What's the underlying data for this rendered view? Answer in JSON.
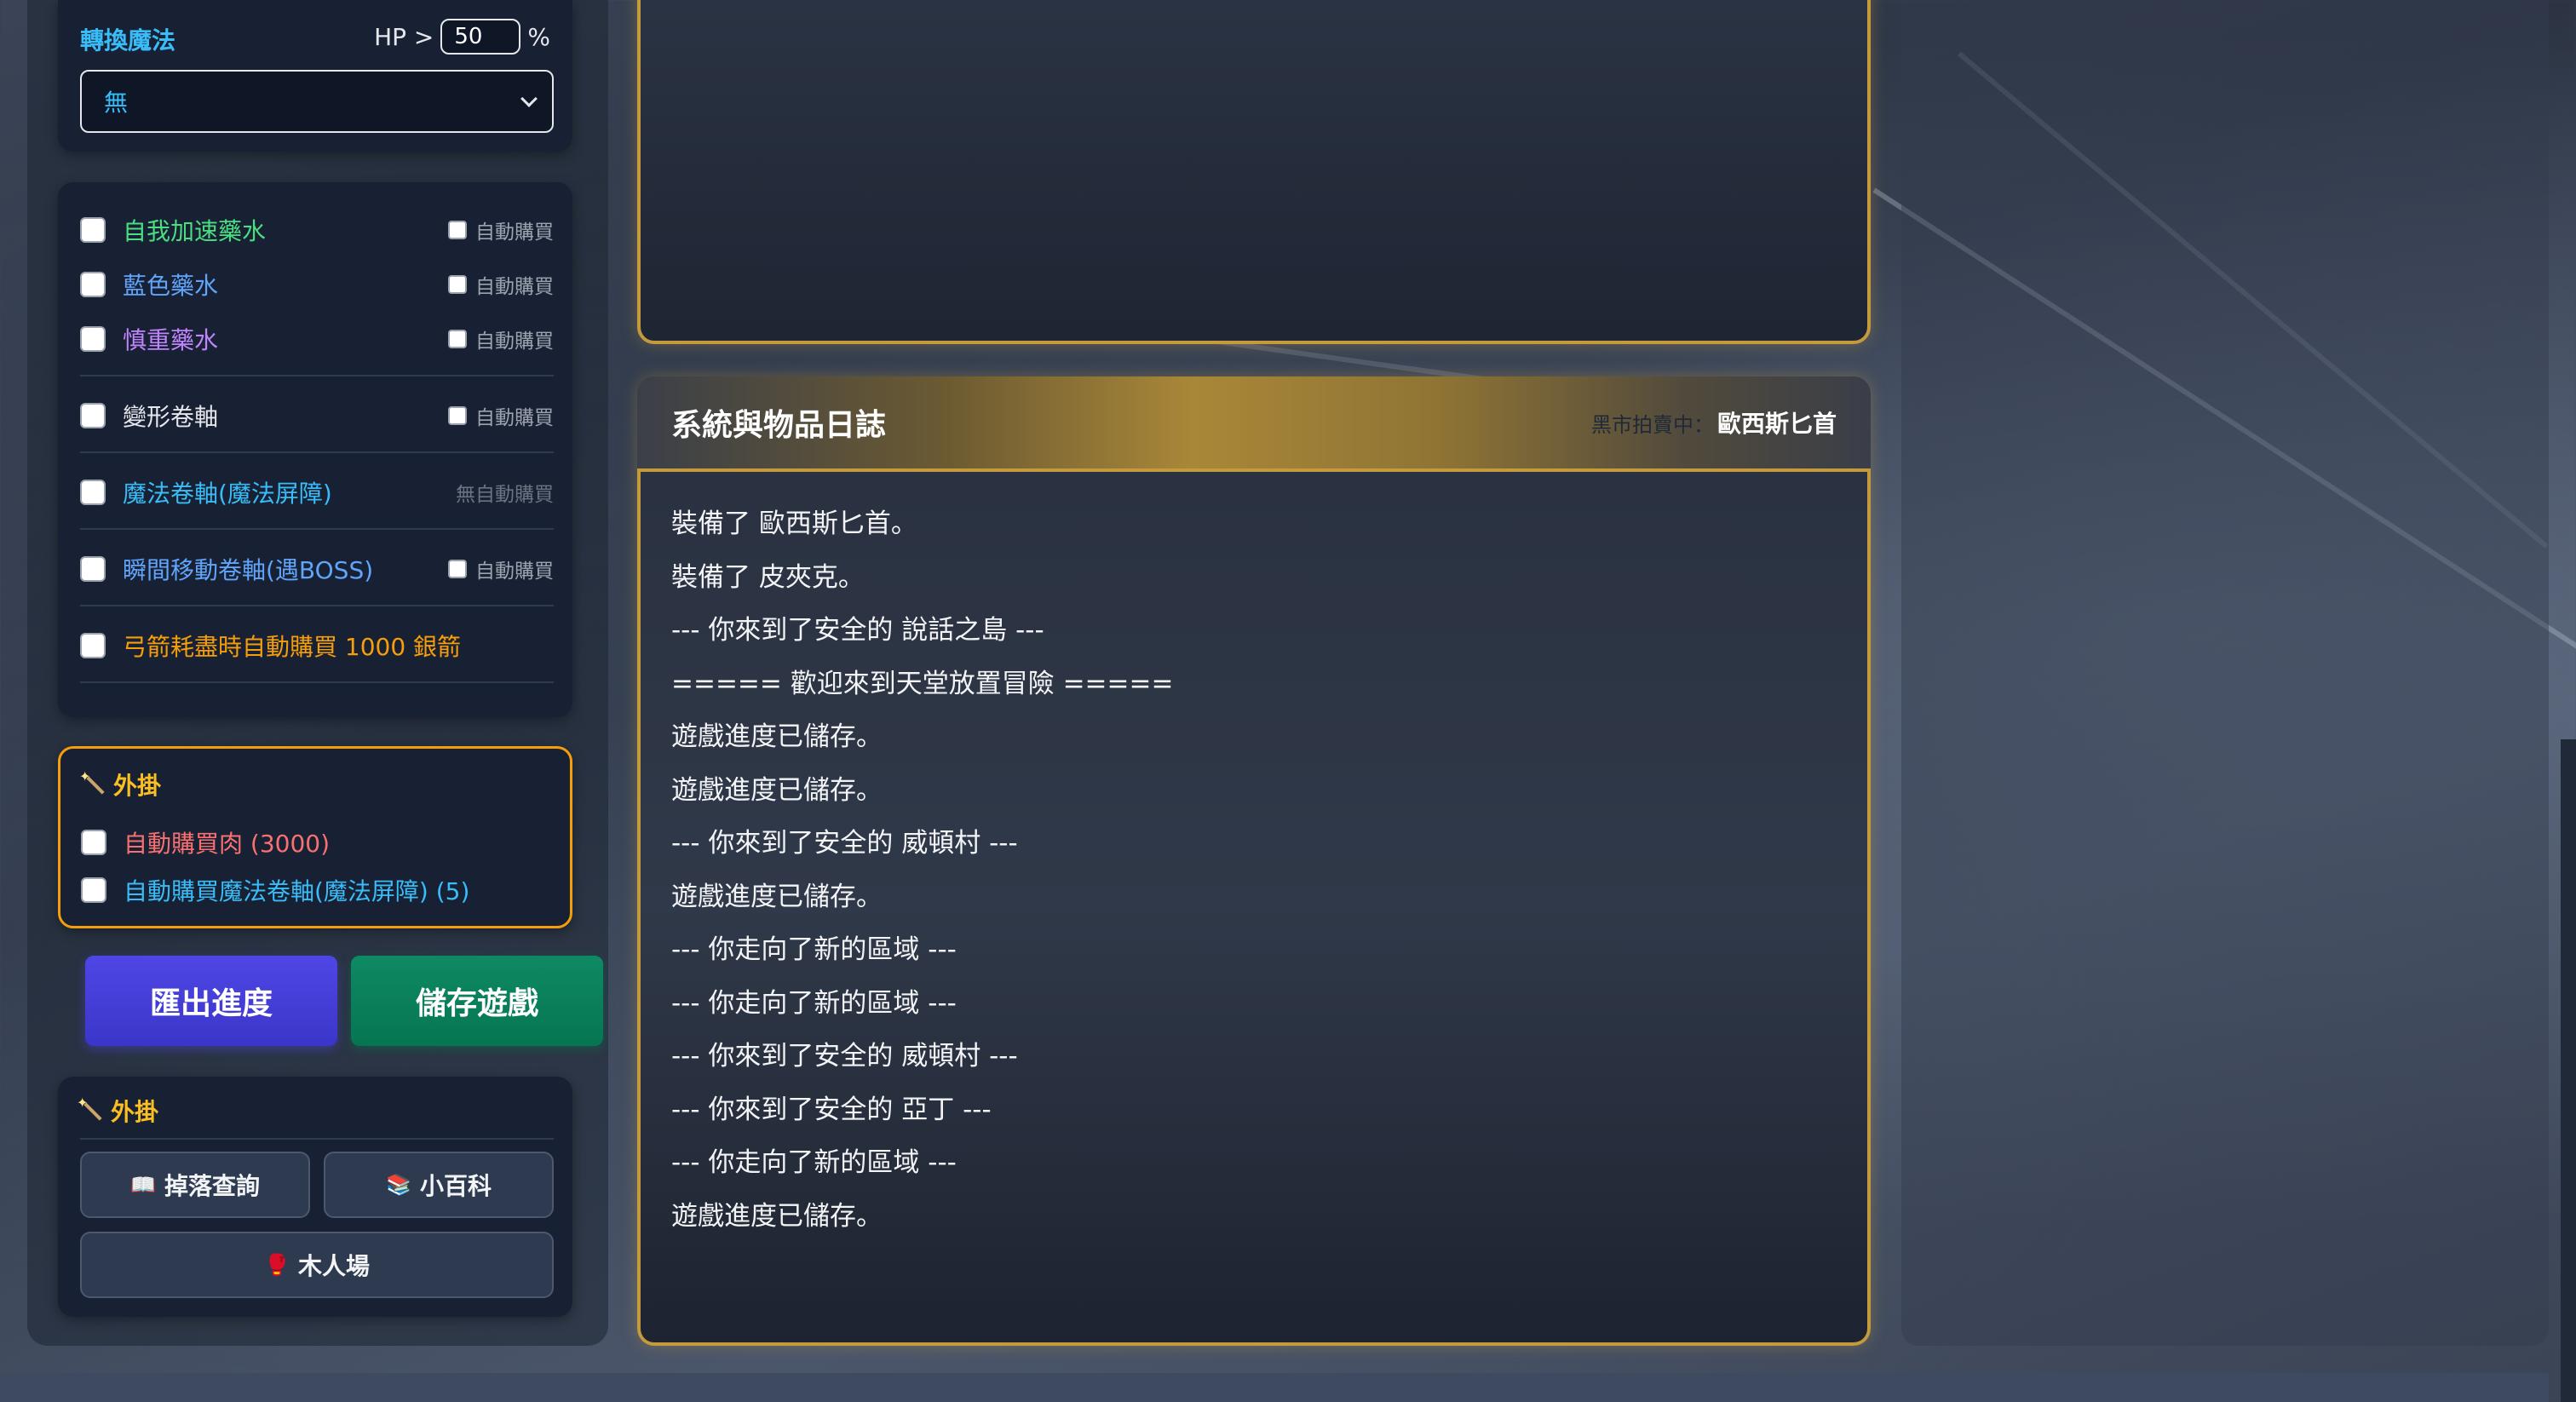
{
  "convert_magic": {
    "title": "轉換魔法",
    "hp_prefix": "HP >",
    "hp_value": "50",
    "hp_suffix": "%",
    "selected": "無"
  },
  "potions": [
    {
      "label": "自我加速藥水",
      "color": "#4ade80",
      "auto_label": "自動購買"
    },
    {
      "label": "藍色藥水",
      "color": "#60a5fa",
      "auto_label": "自動購買"
    },
    {
      "label": "慎重藥水",
      "color": "#c084fc",
      "auto_label": "自動購買"
    },
    {
      "label": "變形卷軸",
      "color": "#e5e7eb",
      "auto_label": "自動購買"
    },
    {
      "label": "魔法卷軸(魔法屏障)",
      "color": "#38bdf8",
      "auto_label": "無自動購買"
    },
    {
      "label": "瞬間移動卷軸(遇BOSS)",
      "color": "#60a5fa",
      "auto_label": "自動購買"
    },
    {
      "label": "弓箭耗盡時自動購買 1000 銀箭",
      "color": "#f59e0b"
    }
  ],
  "hack1": {
    "title": "外掛",
    "items": [
      {
        "label": "自動購買肉 (3000)",
        "color": "#f87171"
      },
      {
        "label": "自動購買魔法卷軸(魔法屏障) (5)",
        "color": "#38bdf8"
      }
    ]
  },
  "buttons": {
    "export": "匯出進度",
    "save": "儲存遊戲"
  },
  "hack2": {
    "title": "外掛",
    "drop_lookup": "掉落查詢",
    "wiki": "小百科",
    "dummy": "木人場"
  },
  "log": {
    "title": "系統與物品日誌",
    "market_label": "黑市拍賣中：",
    "market_item": "歐西斯匕首",
    "lines": [
      "裝備了 歐西斯匕首。",
      "裝備了 皮夾克。",
      "--- 你來到了安全的 說話之島 ---",
      "===== 歡迎來到天堂放置冒險 =====",
      "遊戲進度已儲存。",
      "遊戲進度已儲存。",
      "--- 你來到了安全的 威頓村 ---",
      "遊戲進度已儲存。",
      "--- 你走向了新的區域 ---",
      "--- 你走向了新的區域 ---",
      "--- 你來到了安全的 威頓村 ---",
      "--- 你來到了安全的 亞丁 ---",
      "--- 你走向了新的區域 ---",
      "遊戲進度已儲存。"
    ]
  }
}
